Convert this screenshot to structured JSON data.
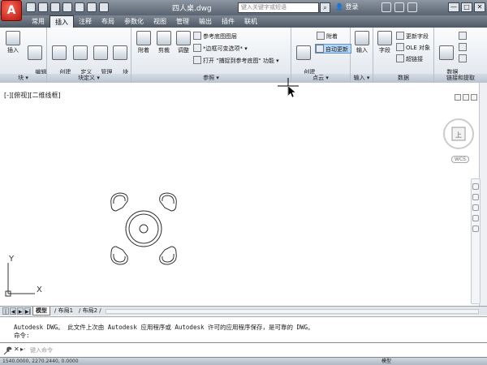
{
  "title_bar": {
    "document_title": "四人桌.dwg",
    "search_placeholder": "键入关键字或短语",
    "login_label": "登录",
    "window_buttons": [
      "—",
      "□",
      "✕"
    ]
  },
  "tabs": [
    "常用",
    "插入",
    "注释",
    "布局",
    "参数化",
    "视图",
    "管理",
    "输出",
    "插件",
    "联机"
  ],
  "active_tab": "插入",
  "ribbon": {
    "panels": [
      {
        "title": "块",
        "buttons": [
          "插入",
          "编辑\n属性"
        ]
      },
      {
        "title": "块定义",
        "buttons": [
          "创建\n块",
          "定义\n属性",
          "管理\n属性",
          "块\n编辑器"
        ]
      },
      {
        "title": "参照",
        "buttons": [
          "附着",
          "剪裁",
          "调整"
        ],
        "small_items": [
          "参考底图图层",
          "*边框可变选项*",
          "打开 \"捕捉到参考底图\" 功能"
        ]
      },
      {
        "title": "点云",
        "buttons": [
          "创建\n点云"
        ],
        "small_items": [
          "附着",
          "自动更新"
        ]
      },
      {
        "title": "输入",
        "buttons": [
          "输入"
        ]
      },
      {
        "title": "数据",
        "buttons": [
          "字段"
        ],
        "small_items": [
          "更新字段",
          "OLE 对象",
          "超链接"
        ]
      },
      {
        "title": "链接和提取",
        "buttons": [
          "数据\n链接"
        ]
      }
    ]
  },
  "viewport": {
    "label": "[-][俯视][二维线框]",
    "viewcube_face": "上",
    "wcs_label": "WCS",
    "ucs_x": "X",
    "ucs_y": "Y"
  },
  "layout_tabs": [
    "模型",
    "布局1",
    "布局2"
  ],
  "active_layout": "模型",
  "command": {
    "history": [
      "Autodesk DWG。  此文件上次由 Autodesk 应用程序或 Autodesk 许可的应用程序保存，是可靠的 DWG。",
      "命令:"
    ],
    "placeholder": "键入命令"
  },
  "status": {
    "coordinates": "1540.0000, 2270.2440, 0.0000",
    "model_label": "模型"
  },
  "colors": {
    "title_bar": "#5a6470",
    "app_button": "#c81e12",
    "ribbon_bg": "#eef2f6",
    "highlight": "#b7d6f5"
  }
}
